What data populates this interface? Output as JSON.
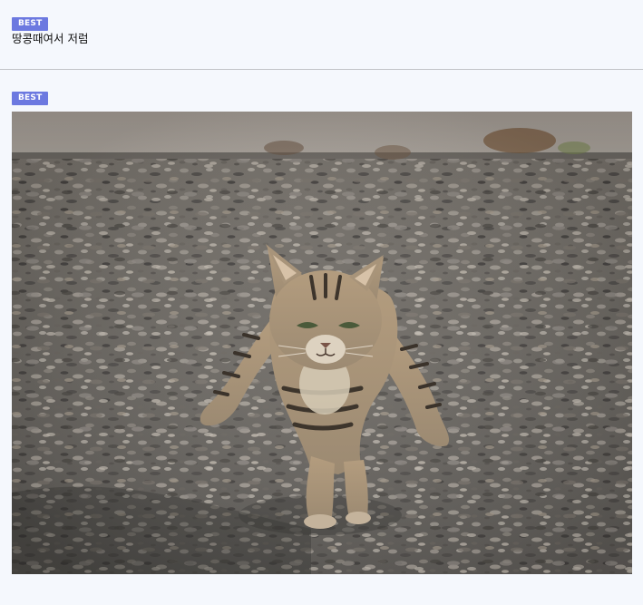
{
  "post_header": {
    "badge_label": "BEST",
    "title": "땅콩때여서 저럼"
  },
  "post_body": {
    "badge_label": "BEST",
    "photo": {
      "subject": "tabby cat walking toward camera on gravel",
      "dominant_colors": [
        "#6e6a66",
        "#9d978e",
        "#a58a6c",
        "#3d3a37"
      ]
    }
  },
  "theme": {
    "background": "#f5f8fd",
    "badge_color": "#6c79e0",
    "divider_color": "#c2c4c8"
  }
}
